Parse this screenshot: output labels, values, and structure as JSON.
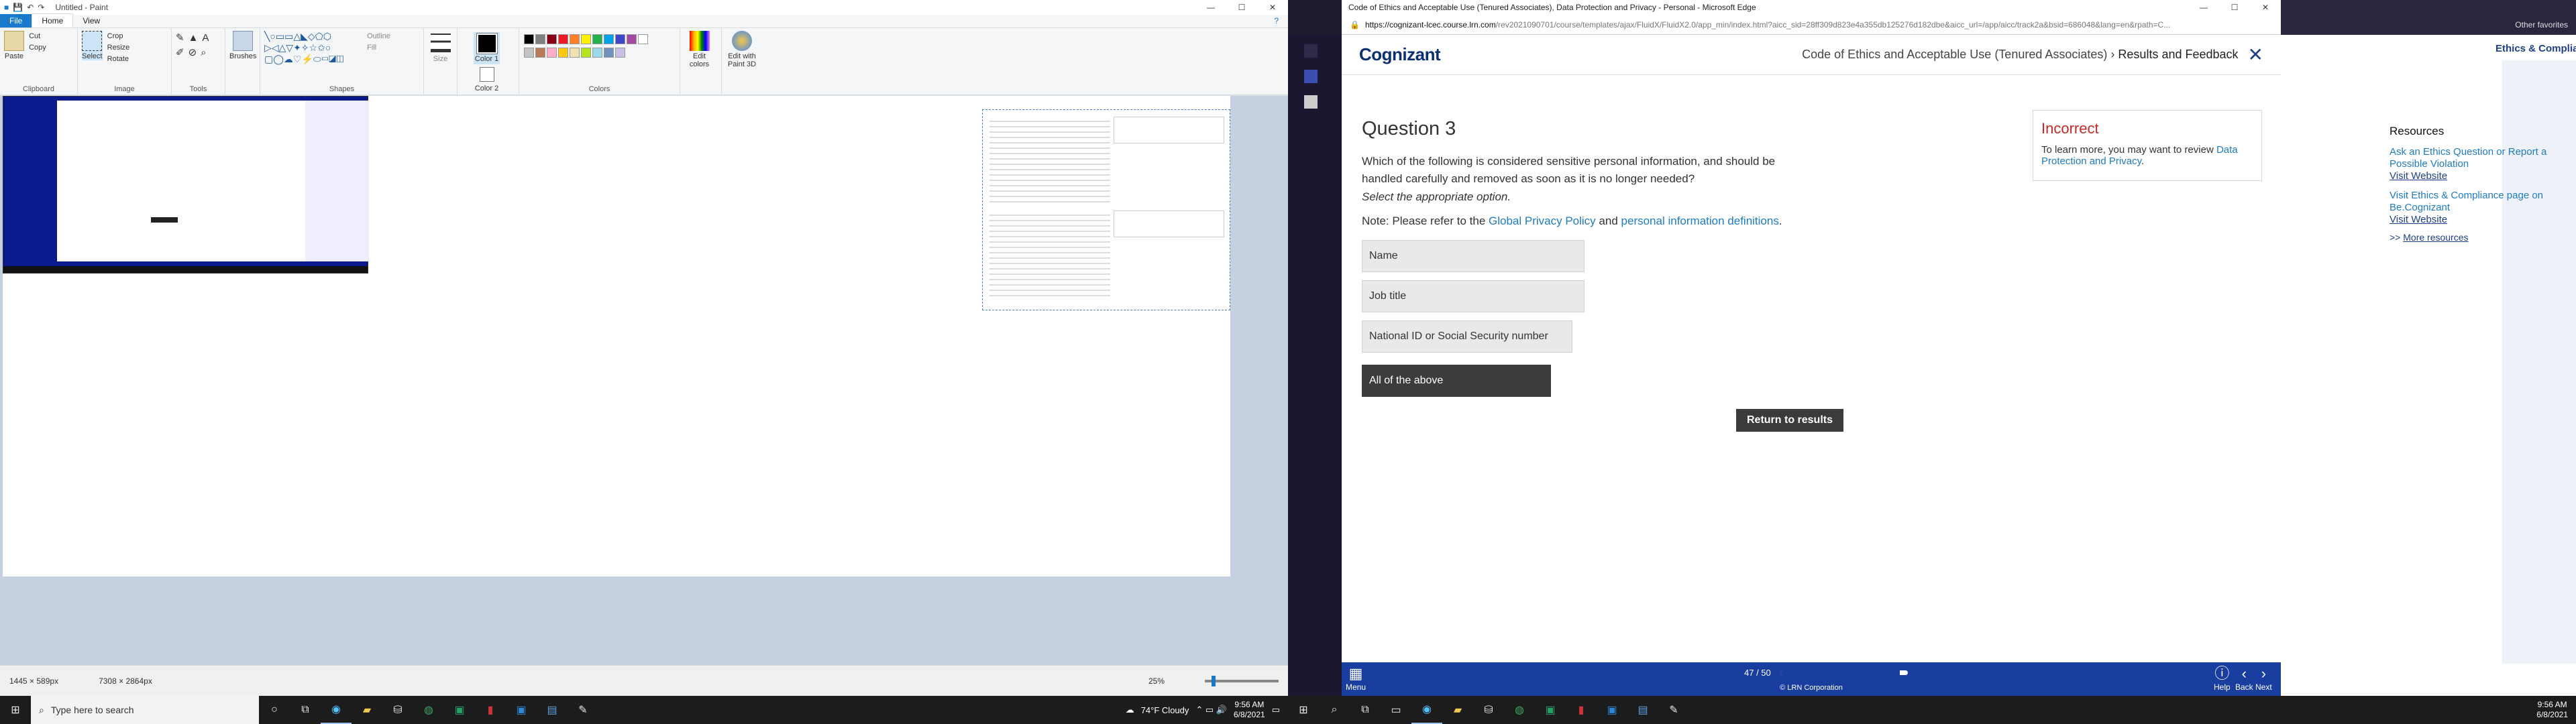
{
  "paint": {
    "title": "Untitled - Paint",
    "tabs": [
      "File",
      "Home",
      "View"
    ],
    "clipboard": {
      "paste": "Paste",
      "cut": "Cut",
      "copy": "Copy",
      "label": "Clipboard"
    },
    "image": {
      "select": "Select",
      "crop": "Crop",
      "resize": "Resize",
      "rotate": "Rotate",
      "label": "Image"
    },
    "tools_label": "Tools",
    "brushes": "Brushes",
    "shapes": {
      "outline": "Outline",
      "fill": "Fill",
      "label": "Shapes"
    },
    "size": "Size",
    "color1": "Color 1",
    "color2": "Color 2",
    "colors_label": "Colors",
    "edit_colors": "Edit colors",
    "edit_paint3d": "Edit with Paint 3D",
    "palette": [
      "#000000",
      "#7f7f7f",
      "#880015",
      "#ed1c24",
      "#ff7f27",
      "#fff200",
      "#22b14c",
      "#00a2e8",
      "#3f48cc",
      "#a349a4",
      "#ffffff",
      "#c3c3c3",
      "#b97a57",
      "#ffaec9",
      "#ffc90e",
      "#efe4b0",
      "#b5e61d",
      "#99d9ea",
      "#7092be",
      "#c8bfe7"
    ],
    "status": {
      "cursor": "1445 × 589px",
      "size": "7308 × 2864px",
      "zoom": "25%"
    }
  },
  "taskbar_left": {
    "search": "Type here to search",
    "weather": "74°F  Cloudy",
    "time": "9:56 AM",
    "date": "6/8/2021"
  },
  "taskbar_right": {
    "time": "9:56 AM",
    "date": "6/8/2021"
  },
  "edge": {
    "title": "Code of Ethics and Acceptable Use (Tenured Associates), Data Protection and Privacy - Personal - Microsoft Edge",
    "url_domain": "https://cognizant-lcec.course.lrn.com",
    "url_rest": "/rev2021090701/course/templates/ajax/FluidX/FluidX2.0/app_min/index.html?aicc_sid=28ff309d823e4a355db125276d182dbe&aicc_url=/app/aicc/track2a&bsid=686048&lang=en&rpath=C...",
    "other_favorites": "Other favorites"
  },
  "course": {
    "logo": "Cognizant",
    "crumb1": "Code of Ethics and Acceptable Use (Tenured Associates)",
    "crumb2": "Results and Feedback",
    "question_title": "Question 3",
    "question_text": "Which of the following is considered sensitive personal information, and should be handled carefully and removed as soon as it is no longer needed?",
    "instruction": "Select the appropriate option.",
    "note_prefix": "Note: Please refer to the",
    "note_link1": "Global Privacy Policy",
    "note_and": "and",
    "note_link2": "personal information definitions",
    "options": [
      "Name",
      "Job title",
      "National ID or Social Security number",
      "All of the above"
    ],
    "selected_index": 3,
    "return_button": "Return to results",
    "feedback": {
      "status": "Incorrect",
      "text": "To learn more, you may want to review",
      "link": "Data Protection and Privacy"
    },
    "footer": {
      "menu": "Menu",
      "progress": "47 / 50",
      "progress_fraction": 0.94,
      "copyright": "© LRN Corporation",
      "help": "Help",
      "back": "Back",
      "next": "Next"
    }
  },
  "ecc": {
    "title": "Ethics & Compliance Center",
    "resources": "Resources",
    "link1": "Ask an Ethics Question or Report a Possible Violation",
    "visit1": "Visit Website",
    "link2": "Visit Ethics & Compliance page on Be.Cognizant",
    "visit2": "Visit Website",
    "more": "More resources"
  }
}
